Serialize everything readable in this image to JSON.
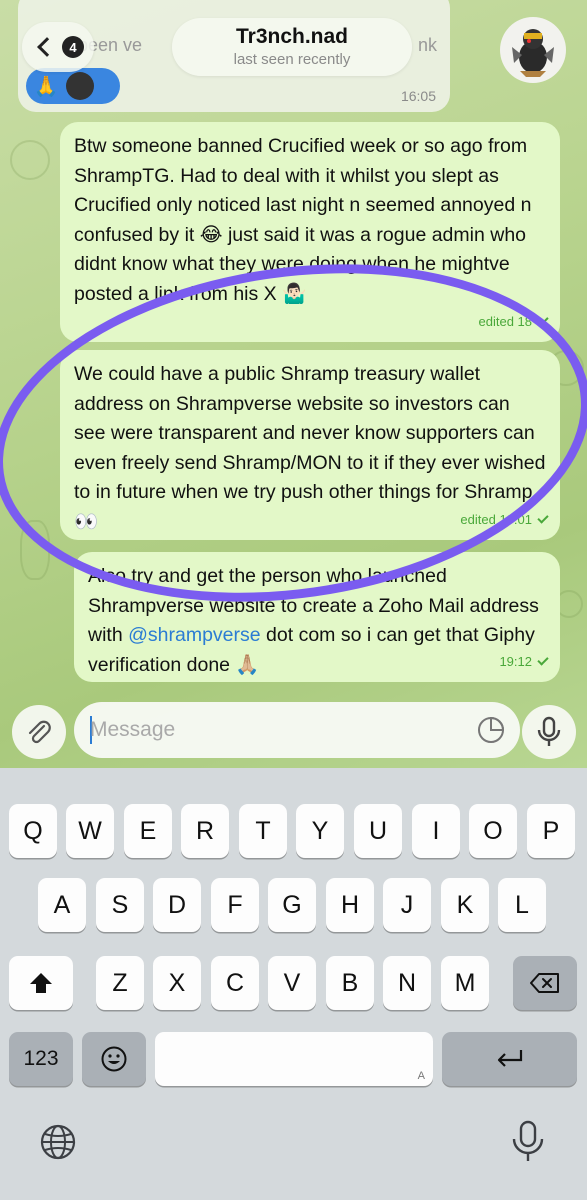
{
  "header": {
    "back_count": "4",
    "contact_name": "Tr3nch.nad",
    "contact_status": "last seen recently"
  },
  "received_top": {
    "faded_text_left": "been ve",
    "faded_text_right": "nk",
    "reaction_1": "🙏",
    "time": "16:05"
  },
  "messages": [
    {
      "text": "Btw someone banned Crucified week or so ago from ShrampTG. Had to deal with it whilst you slept as Crucified only noticed last night n seemed annoyed n confused by it 😂 just said it was a rogue admin who didnt know what they were doing when he mightve posted a link from his X 🤷🏻‍♂️",
      "meta": "edited 18"
    },
    {
      "text": "We could have a public Shramp treasury wallet address on Shrampverse website so investors can see were transparent and never know supporters can even freely send Shramp/MON to it if they ever wished to in future when we try push other things for Shramp 👀",
      "meta": "edited 19:01"
    },
    {
      "text_before": "Also try and get the person who launched Shrampverse website to create a Zoho Mail address with ",
      "mention": "@shrampverse",
      "text_after": " dot com so i can get that Giphy verification done 🙏🏼",
      "meta": "19:12"
    }
  ],
  "composer": {
    "placeholder": "Message"
  },
  "keyboard": {
    "row1": [
      "Q",
      "W",
      "E",
      "R",
      "T",
      "Y",
      "U",
      "I",
      "O",
      "P"
    ],
    "row2": [
      "A",
      "S",
      "D",
      "F",
      "G",
      "H",
      "J",
      "K",
      "L"
    ],
    "row3": [
      "Z",
      "X",
      "C",
      "V",
      "B",
      "N",
      "M"
    ],
    "numbers_label": "123",
    "space_hint": "A"
  },
  "colors": {
    "outgoing_bubble": "#e3f8c8",
    "annotation_circle": "#7a5cf0",
    "mention": "#2b7cd3",
    "keyboard_bg": "#d4d9dc"
  }
}
